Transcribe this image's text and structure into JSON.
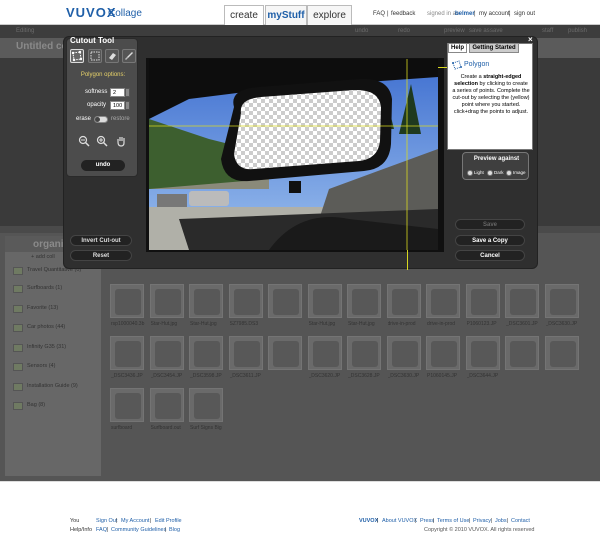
{
  "header": {
    "logo": "VUVOX",
    "logo_sub": "Collage",
    "tabs": [
      "create",
      "myStuff",
      "explore"
    ],
    "faq": "FAQ",
    "feedback": "feedback",
    "signed_in_prefix": "signed in as",
    "username": "belmer",
    "my_account": "my account",
    "sign_out": "sign out"
  },
  "toolbar": {
    "items": [
      "Editing",
      "undo",
      "redo",
      "preview",
      "save as",
      "save",
      "staff",
      "publish"
    ],
    "doc_title": "Untitled coll"
  },
  "organize": {
    "title": "organi",
    "add_label": "+ add coll",
    "folders": [
      "Travel Quantitative (0)",
      "Surfboards (1)",
      "Favorite (13)",
      "Car photos (44)",
      "Infinity G35 (31)",
      "Sensors (4)",
      "Installation Guide (9)",
      "Bag (8)"
    ]
  },
  "thumbnails": [
    "rsp1000040.3b",
    "Star-Hut.jpg",
    "Star-Hut.jpg",
    "SZ7985.DS3",
    "",
    "Star-Hut.jpg",
    "Star-Hut.jpg",
    "drive-in-prod",
    "drive-in-prod",
    "P1060123.JP",
    "_DSC3601.JP",
    "_DSC3630.JP",
    "_DSC3436.JP",
    "_DSC3454.JP",
    "_DSC3598.JP",
    "_DSC3611.JP",
    "",
    "_DSC3620.JP",
    "_DSC3628.JP",
    "_DSC3630.JP",
    "P1060145.JP",
    "_DSC3644.JP",
    "",
    "",
    "surfboard",
    "Surfboard.out",
    "Surf Signs Big"
  ],
  "cutout": {
    "title": "Cutout Tool",
    "tool_icons": [
      "polygon-select-icon",
      "rect-select-icon",
      "eraser-icon",
      "brush-icon"
    ],
    "polygon_options": "Polygon options:",
    "softness_label": "softness",
    "softness_value": "2",
    "opacity_label": "opacity",
    "opacity_value": "100",
    "erase_label": "erase",
    "restore_label": "restore",
    "undo_label": "undo",
    "invert_label": "Invert Cut-out",
    "reset_label": "Reset",
    "save_label": "Save",
    "save_copy_label": "Save a Copy",
    "cancel_label": "Cancel"
  },
  "help": {
    "tab_help": "Help",
    "tab_started": "Getting Started",
    "close": "×",
    "heading": "Polygon",
    "body_1": "Create a ",
    "body_bold": "straight-edged selection",
    "body_2": " by clicking to create a series of points. Complete the cut-out by selecting the (yellow) point where you started. click+drag the points to adjust."
  },
  "preview": {
    "title": "Preview against",
    "options": [
      "Light",
      "Dark",
      "Image"
    ]
  },
  "footer": {
    "you": "You",
    "you_links": [
      "Sign Out",
      "My Account",
      "Edit Profile"
    ],
    "help_info": "Help/Info",
    "help_links": [
      "FAQ",
      "Community Guidelines",
      "Blog"
    ],
    "site_links": [
      "VUVOX",
      "About VUVOX",
      "Press",
      "Terms of Use",
      "Privacy",
      "Jobs",
      "Contact"
    ],
    "copyright": "Copyright © 2010 VUVOX. All rights reserved"
  },
  "colors": {
    "accent": "#1f5fa8",
    "option_label": "#e8d36a",
    "guide_line": "#d8d820"
  }
}
